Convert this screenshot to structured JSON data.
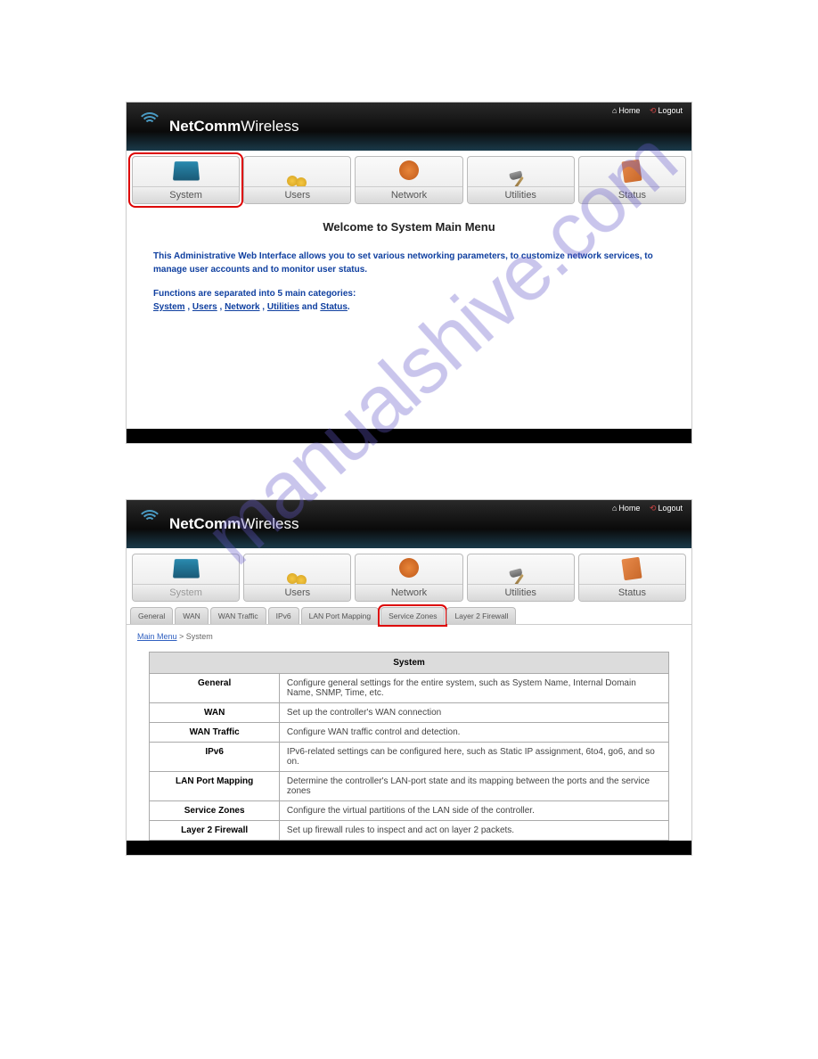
{
  "header": {
    "brand_bold": "NetComm",
    "brand_light": "Wireless",
    "home": "Home",
    "logout": "Logout"
  },
  "nav": {
    "system": "System",
    "users": "Users",
    "network": "Network",
    "utilities": "Utilities",
    "status": "Status"
  },
  "panel1": {
    "title": "Welcome to System Main Menu",
    "intro": "This Administrative Web Interface allows you to set various networking parameters, to customize network services, to manage user accounts and to monitor user status.",
    "functions_prefix": "Functions are separated into 5 main categories:",
    "links": {
      "system": "System",
      "users": "Users",
      "network": "Network",
      "utilities": "Utilities",
      "status": "Status"
    },
    "sep_comma": " , ",
    "sep_and": " and ",
    "period": "."
  },
  "subnav": {
    "general": "General",
    "wan": "WAN",
    "wan_traffic": "WAN Traffic",
    "ipv6": "IPv6",
    "lan_port_mapping": "LAN Port Mapping",
    "service_zones": "Service Zones",
    "layer2_firewall": "Layer 2 Firewall"
  },
  "breadcrumb": {
    "main_menu": "Main Menu",
    "sep": " > ",
    "current": "System"
  },
  "table": {
    "header": "System",
    "rows": [
      {
        "label": "General",
        "desc": "Configure general settings for the entire system, such as System Name, Internal Domain Name, SNMP, Time, etc."
      },
      {
        "label": "WAN",
        "desc": "Set up the controller's WAN connection"
      },
      {
        "label": "WAN Traffic",
        "desc": "Configure WAN traffic control and detection."
      },
      {
        "label": "IPv6",
        "desc": "IPv6-related settings can be configured here, such as Static IP assignment, 6to4, go6, and so on."
      },
      {
        "label": "LAN Port Mapping",
        "desc": "Determine the controller's LAN-port state and its mapping between the ports and the service zones"
      },
      {
        "label": "Service Zones",
        "desc": "Configure the virtual partitions of the LAN side of the controller."
      },
      {
        "label": "Layer 2 Firewall",
        "desc": "Set up firewall rules to inspect and act on layer 2 packets."
      }
    ]
  },
  "watermark": "manualshive.com"
}
